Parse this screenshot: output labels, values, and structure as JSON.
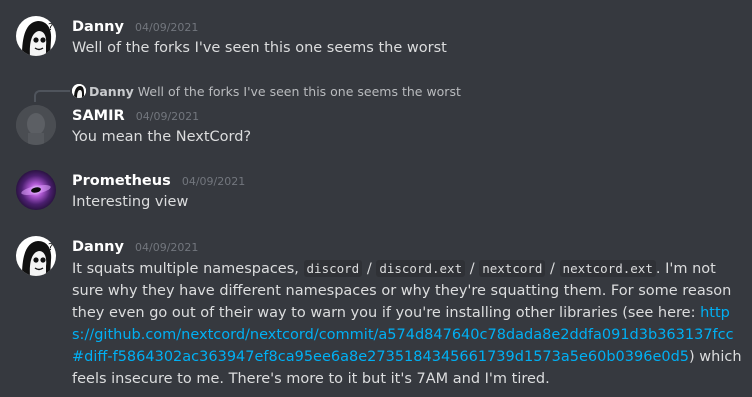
{
  "messages": [
    {
      "username": "Danny",
      "timestamp": "04/09/2021",
      "text": "Well of the forks I've seen this one seems the worst"
    },
    {
      "reply_to": {
        "username": "Danny",
        "text": "Well of the forks I've seen this one seems the worst"
      },
      "username": "SAMIR",
      "timestamp": "04/09/2021",
      "text": "You mean the NextCord?"
    },
    {
      "username": "Prometheus",
      "timestamp": "04/09/2021",
      "text": "Interesting view"
    },
    {
      "username": "Danny",
      "timestamp": "04/09/2021",
      "parts": {
        "intro": "It squats multiple namespaces,",
        "code1": "discord",
        "sep1": "/",
        "code2": "discord.ext",
        "sep2": "/",
        "code3": "nextcord",
        "sep3": "/",
        "code4": "nextcord.ext",
        "middle": ". I'm not sure why they have different namespaces or why they're squatting them. For some reason they even go out of their way to warn you if you're installing other libraries (see here:",
        "link": "https://github.com/nextcord/nextcord/commit/a574d847640c78dada8e2ddfa091d3b363137fcc#diff-f5864302ac363947ef8ca95ee6a8e2735184345661739d1573a5e60b0396e0d5",
        "outro": ") which feels insecure to me. There's more to it but it's 7AM and I'm tired."
      }
    }
  ],
  "colors": {
    "background": "#36393f",
    "username": "#ffffff",
    "timestamp": "#72767d",
    "link": "#00b0f4",
    "code_bg": "#2f3136"
  },
  "icons": {
    "danny_avatar": "white-skull-cartoon-avatar",
    "samir_avatar": "grey-blurred-avatar",
    "prometheus_avatar": "purple-galaxy-avatar"
  }
}
